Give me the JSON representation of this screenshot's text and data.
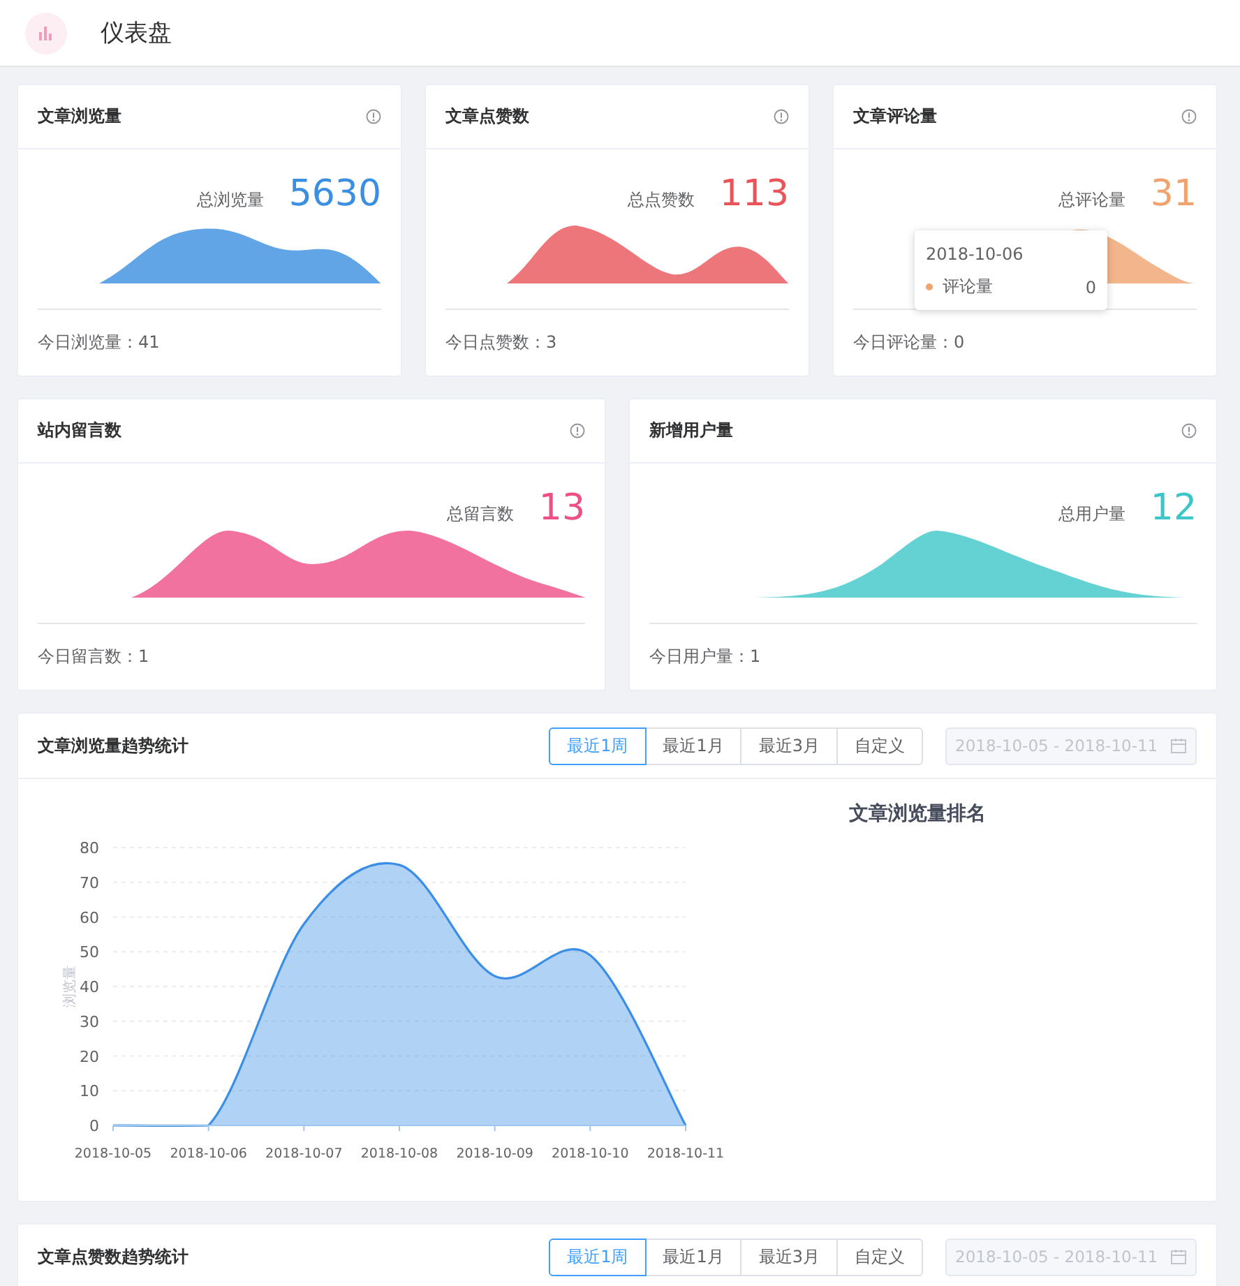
{
  "header": {
    "title": "仪表盘"
  },
  "stat_rows": [
    {
      "cards": [
        {
          "title": "文章浏览量",
          "total_label": "总浏览量",
          "total": "5630",
          "today": "今日浏览量：41",
          "color": "#3b8fe0"
        },
        {
          "title": "文章点赞数",
          "total_label": "总点赞数",
          "total": "113",
          "today": "今日点赞数：3",
          "color": "#e8545a"
        },
        {
          "title": "文章评论量",
          "total_label": "总评论量",
          "total": "31",
          "today": "今日评论量：0",
          "color": "#f0a36e",
          "tooltip": {
            "date": "2018-10-06",
            "series": "评论量",
            "value": "0"
          }
        }
      ]
    },
    {
      "cards": [
        {
          "title": "站内留言数",
          "total_label": "总留言数",
          "total": "13",
          "today": "今日留言数：1",
          "color": "#ed4f86"
        },
        {
          "title": "新增用户量",
          "total_label": "总用户量",
          "total": "12",
          "today": "今日用户量：1",
          "color": "#3dc6c8"
        }
      ]
    }
  ],
  "trend_cards": [
    {
      "title": "文章浏览量趋势统计",
      "ranges": [
        {
          "label": "最近1周",
          "selected": true
        },
        {
          "label": "最近1月",
          "selected": false
        },
        {
          "label": "最近3月",
          "selected": false
        },
        {
          "label": "自定义",
          "selected": false
        }
      ],
      "date_range": "2018-10-05 - 2018-10-11",
      "date_disabled": true,
      "chart_data": {
        "type": "area",
        "ylabel": "浏览量",
        "categories": [
          "2018-10-05",
          "2018-10-06",
          "2018-10-07",
          "2018-10-08",
          "2018-10-09",
          "2018-10-10",
          "2018-10-11"
        ],
        "grid": true,
        "series": [
          {
            "color": "#3a8ee6",
            "values": [
              0,
              0,
              58,
              75,
              43,
              49,
              0
            ]
          }
        ],
        "ylim": [
          0,
          80
        ],
        "yticks": [
          0,
          10,
          20,
          30,
          40,
          50,
          60,
          70,
          80
        ]
      },
      "ranking_title": "文章浏览量排名"
    },
    {
      "title": "文章点赞数趋势统计",
      "ranges": [
        {
          "label": "最近1周",
          "selected": true
        },
        {
          "label": "最近1月",
          "selected": false
        },
        {
          "label": "最近3月",
          "selected": false
        },
        {
          "label": "自定义",
          "selected": false
        }
      ],
      "date_range": "2018-10-05 - 2018-10-11",
      "date_disabled": true
    }
  ]
}
